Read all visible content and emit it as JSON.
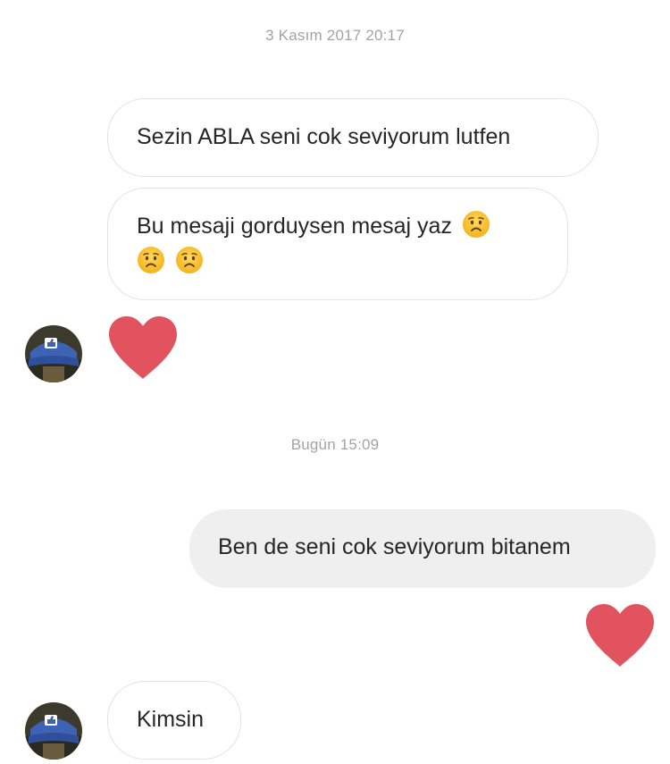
{
  "conversation": {
    "timestamp_1": "3 Kasım 2017 20:17",
    "timestamp_2": "Bugün 15:09",
    "messages": [
      {
        "direction": "incoming",
        "text": "Sezin ABLA seni cok seviyorum lutfen"
      },
      {
        "direction": "incoming",
        "text_line1": "Bu mesaji gorduysen mesaj yaz",
        "emoji": "worried-face-emoji",
        "emoji_count": 3
      },
      {
        "direction": "incoming",
        "type": "like-heart"
      },
      {
        "direction": "outgoing",
        "text": "Ben de seni cok seviyorum bitanem"
      },
      {
        "direction": "outgoing",
        "type": "like-heart"
      },
      {
        "direction": "incoming",
        "text": "Kimsin"
      }
    ]
  },
  "colors": {
    "heart": "#e1535f",
    "outgoing_bubble": "#efefef",
    "incoming_border": "#e3e3e3",
    "timestamp": "#a3a3a3",
    "text": "#262626"
  },
  "avatar": {
    "icon": "user-avatar-blue-cap"
  }
}
